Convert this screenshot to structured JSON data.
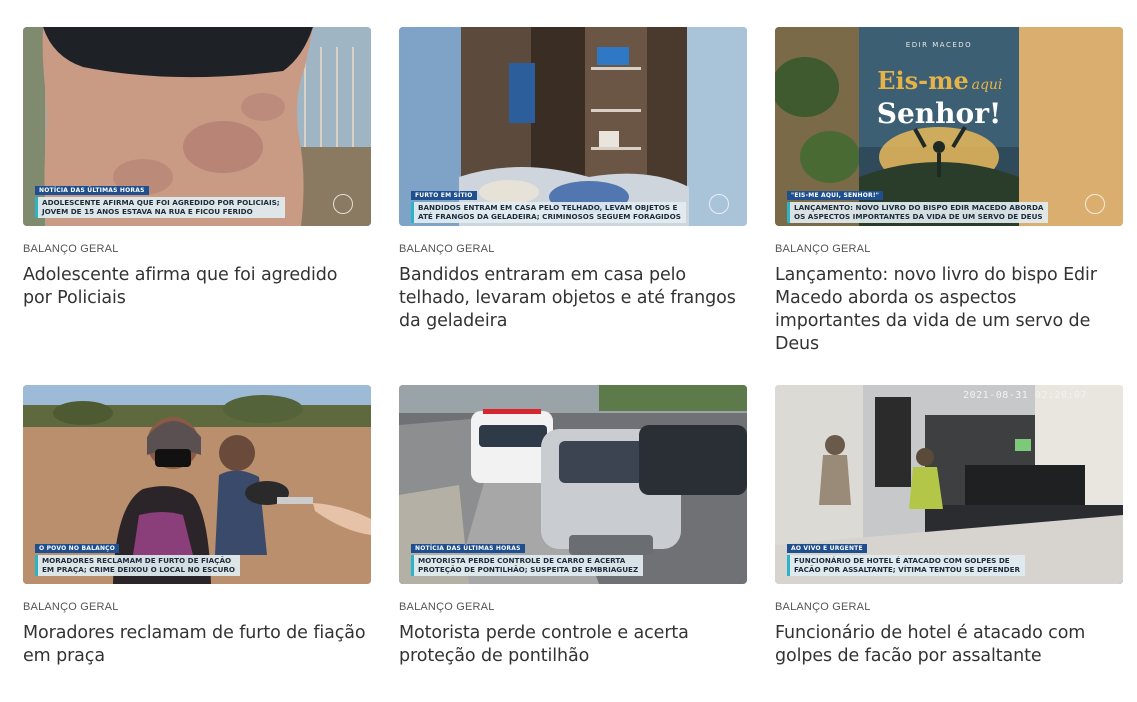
{
  "cards": [
    {
      "section": "BALANÇO GERAL",
      "headline": "Adolescente afirma que foi agredido por Policiais",
      "image_desc": "back-with-bruises",
      "overlay": {
        "tag": "NOTÍCIA DAS ÚLTIMAS HORAS",
        "line1": "ADOLESCENTE AFIRMA QUE FOI AGREDIDO POR POLICIAIS;",
        "line2": "JOVEM DE 15 ANOS ESTAVA NA RUA E FICOU FERIDO"
      }
    },
    {
      "section": "BALANÇO GERAL",
      "headline": "Bandidos entraram em casa pelo telhado, levaram objetos e até frangos da geladeira",
      "image_desc": "ransacked-wardrobe",
      "overlay": {
        "tag": "FURTO EM SÍTIO",
        "line1": "BANDIDOS ENTRAM EM CASA PELO TELHADO, LEVAM OBJETOS E",
        "line2": "ATÉ FRANGOS DA GELADEIRA; CRIMINOSOS SEGUEM FORAGIDOS"
      }
    },
    {
      "section": "BALANÇO GERAL",
      "headline": "Lançamento: novo livro do bispo Edir Macedo aborda os aspectos importantes da vida de um servo de Deus",
      "image_desc": "book-cover",
      "book": {
        "author": "EDIR MACEDO",
        "title1": "Eis-me",
        "title2": "aqui",
        "title3": "Senhor!"
      },
      "overlay": {
        "tag": "\"EIS-ME AQUI, SENHOR!\"",
        "line1": "LANÇAMENTO: NOVO LIVRO DO BISPO EDIR MACEDO ABORDA",
        "line2": "OS ASPECTOS IMPORTANTES DA VIDA DE UM SERVO DE DEUS"
      }
    },
    {
      "section": "BALANÇO GERAL",
      "headline": "Moradores reclamam de furto de fiação em praça",
      "image_desc": "woman-interview",
      "overlay": {
        "tag": "O POVO NO BALANÇO",
        "line1": "MORADORES RECLAMAM DE FURTO  DE FIAÇÃO",
        "line2": "EM PRAÇA; CRIME DEIXOU O LOCAL NO ESCURO"
      }
    },
    {
      "section": "BALANÇO GERAL",
      "headline": "Motorista perde controle e acerta proteção de pontilhão",
      "image_desc": "car-accident",
      "overlay": {
        "tag": "NOTÍCIA DAS ÚLTIMAS HORAS",
        "line1": "MOTORISTA PERDE CONTROLE DE CARRO E ACERTA",
        "line2": "PROTEÇÃO DE PONTILHÃO; SUSPEITA DE EMBRIAGUEZ"
      }
    },
    {
      "section": "BALANÇO GERAL",
      "headline": "Funcionário de hotel é atacado com golpes de facão por assaltante",
      "image_desc": "cctv-hotel-lobby",
      "timestamp": "2021-08-31 02:20:07",
      "overlay": {
        "tag": "AO VIVO E URGENTE",
        "line1": "FUNCIONÁRIO DE HOTEL É ATACADO COM GOLPES DE",
        "line2": "FACÃO POR ASSALTANTE; VÍTIMA TENTOU SE DEFENDER"
      }
    }
  ]
}
